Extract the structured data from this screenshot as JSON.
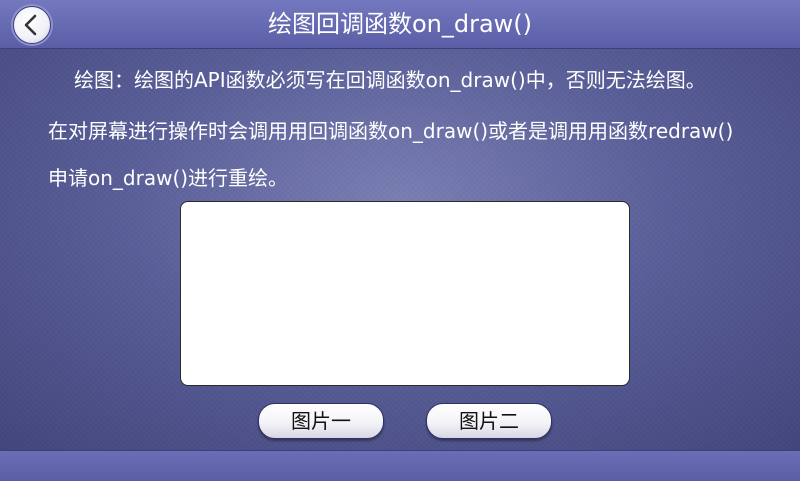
{
  "header": {
    "title": "绘图回调函数on_draw()",
    "back_icon": "chevron-left-icon"
  },
  "description": {
    "line1": "绘图：绘图的API函数必须写在回调函数on_draw()中，否则无法绘图。",
    "line2": "在对屏幕进行操作时会调用用回调函数on_draw()或者是调用用函数redraw()",
    "line3": "申请on_draw()进行重绘。"
  },
  "buttons": {
    "picture1_label": "图片一",
    "picture2_label": "图片二"
  },
  "colors": {
    "background": "#595e98",
    "title_bar": "#6a6eb4",
    "canvas": "#ffffff"
  }
}
